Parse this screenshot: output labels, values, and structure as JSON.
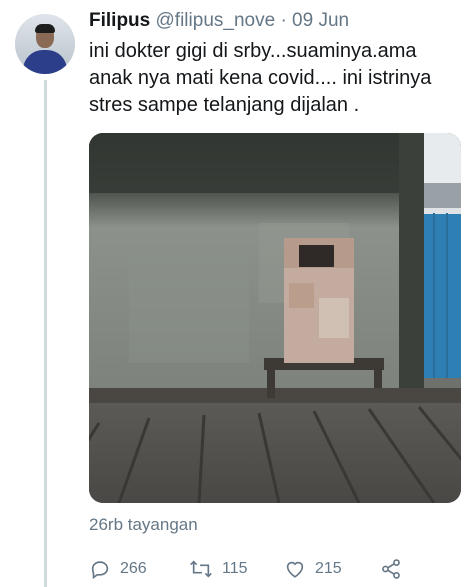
{
  "tweet": {
    "display_name": "Filipus",
    "handle": "@filipus_nove",
    "separator": "·",
    "date": "09 Jun",
    "text_lines": [
      "ini dokter gigi di srby...suaminya.ama",
      "anak nya mati kena covid.... ini istrinya",
      "stres sampe telanjang dijalan  ."
    ],
    "views": "26rb tayangan"
  },
  "actions": {
    "reply_count": "266",
    "retweet_count": "115",
    "like_count": "215",
    "reply_icon": "reply-icon",
    "retweet_icon": "retweet-icon",
    "like_icon": "heart-icon",
    "share_icon": "share-icon"
  },
  "colors": {
    "muted_text": "#657786",
    "primary_text": "#14171a",
    "thread_line": "#cfd9de"
  }
}
